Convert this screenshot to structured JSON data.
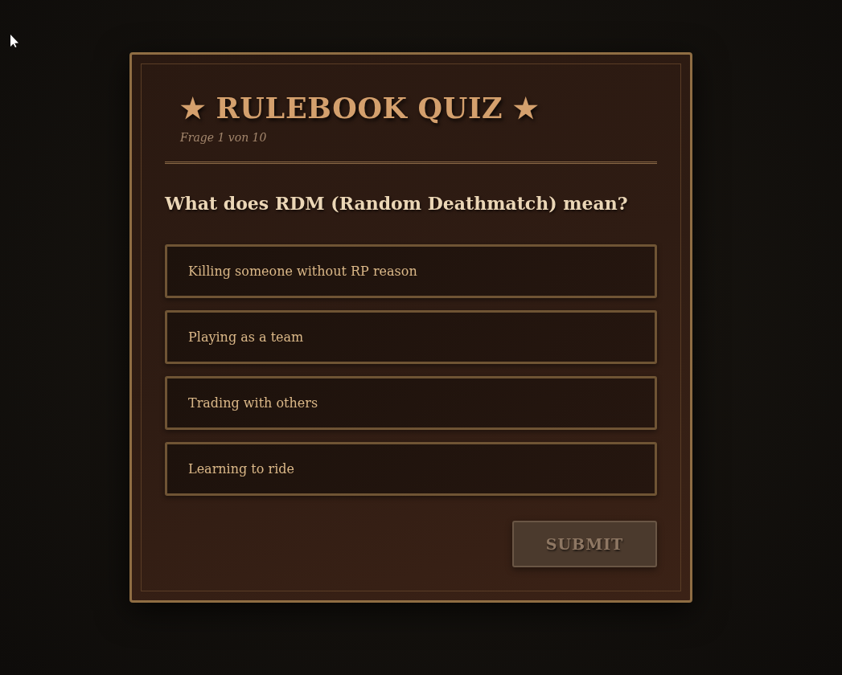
{
  "quiz": {
    "title": "★ RULEBOOK QUIZ ★",
    "counter": "Frage 1 von 10",
    "question": "What does RDM (Random Deathmatch) mean?",
    "options": [
      {
        "label": "Killing someone without RP reason",
        "selected": false
      },
      {
        "label": "Playing as a team",
        "selected": false
      },
      {
        "label": "Trading with others",
        "selected": false
      },
      {
        "label": "Learning to ride",
        "selected": false
      }
    ],
    "submit": {
      "label": "SUBMIT",
      "disabled": true
    }
  }
}
